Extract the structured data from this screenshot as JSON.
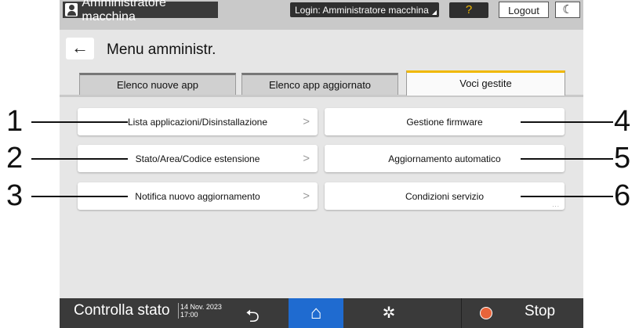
{
  "topbar": {
    "user_label": "Amministratore macchina",
    "login_label": "Login: Amministratore macchina",
    "help_label": "?",
    "logout_label": "Logout",
    "moon_label": "☾"
  },
  "header": {
    "back_label": "←",
    "title": "Menu amministr."
  },
  "tabs": [
    {
      "label": "Elenco nuove app"
    },
    {
      "label": "Elenco app aggiornato"
    },
    {
      "label": "Voci gestite"
    }
  ],
  "items": [
    {
      "label": "Lista applicazioni/Disinstallazione",
      "chevron": ">"
    },
    {
      "label": "Stato/Area/Codice estensione",
      "chevron": ">"
    },
    {
      "label": "Notifica nuovo aggiornamento",
      "chevron": ">"
    },
    {
      "label": "Gestione firmware"
    },
    {
      "label": "Aggiornamento automatico"
    },
    {
      "label": "Condizioni servizio",
      "more": "..."
    }
  ],
  "bottombar": {
    "status_label": "Controlla stato",
    "date": "14 Nov. 2023",
    "time": "17:00",
    "stop_label": "Stop"
  },
  "callouts": [
    "1",
    "2",
    "3",
    "4",
    "5",
    "6"
  ],
  "colors": {
    "accent": "#f0b800",
    "home_active": "#1f6bd0",
    "bar_dark": "#3a3a3a",
    "stop_icon": "#e8643a"
  }
}
